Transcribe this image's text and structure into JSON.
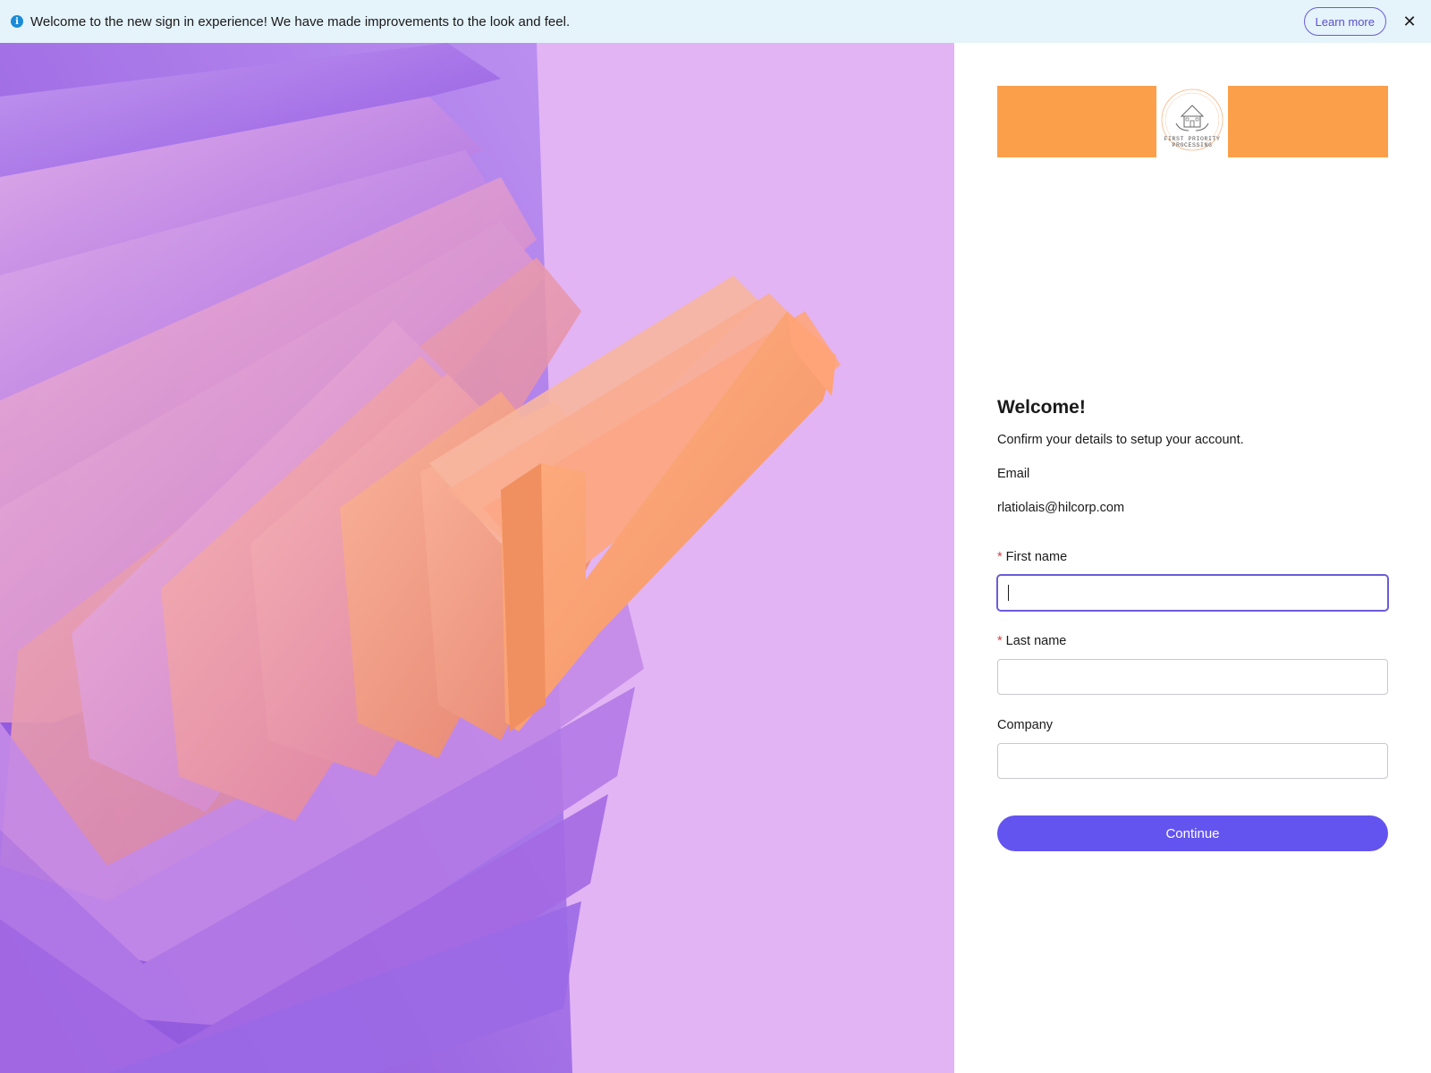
{
  "banner": {
    "icon": "info-icon",
    "message": "Welcome to the new sign in experience! We have made improvements to the look and feel.",
    "learn_more_label": "Learn more",
    "close_icon": "close-icon"
  },
  "logo": {
    "caption_line1": "FIRST PRIORITY",
    "caption_line2": "PROCESSING",
    "color": "#fc9f4b"
  },
  "form": {
    "title": "Welcome!",
    "subtitle": "Confirm your details to setup your account.",
    "email_label": "Email",
    "email_value": "rlatiolais@hilcorp.com",
    "required_marker": "*",
    "first_name_label": "First name",
    "first_name_value": "",
    "last_name_label": "Last name",
    "last_name_value": "",
    "company_label": "Company",
    "company_value": "",
    "continue_label": "Continue"
  },
  "colors": {
    "accent": "#6354f0",
    "banner_bg": "#e5f3fb",
    "art_bg": "#e2b4f4",
    "required": "#d93d3d"
  }
}
